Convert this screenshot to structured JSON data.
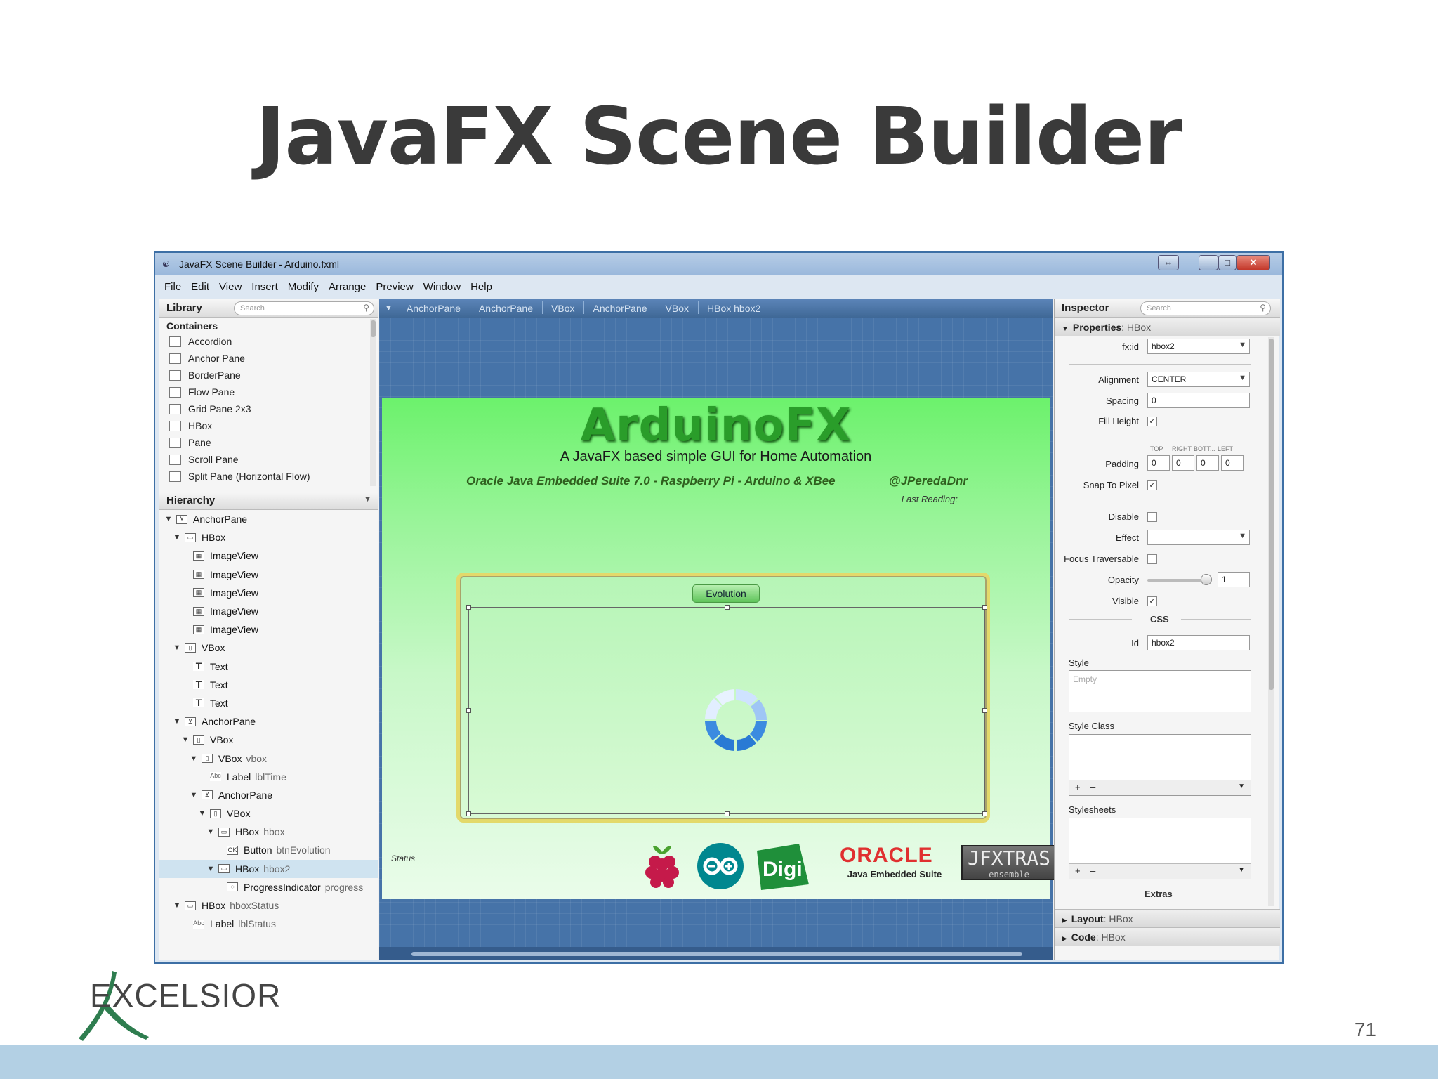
{
  "slide": {
    "title": "JavaFX Scene Builder",
    "page_number": "71",
    "logo_text": "EXCELSIOR"
  },
  "window": {
    "title": "JavaFX Scene Builder - Arduino.fxml",
    "buttons": {
      "restore": "⇔",
      "minimize": "–",
      "maximize": "□",
      "close": "✕"
    }
  },
  "menu": [
    "File",
    "Edit",
    "View",
    "Insert",
    "Modify",
    "Arrange",
    "Preview",
    "Window",
    "Help"
  ],
  "library": {
    "title": "Library",
    "search_placeholder": "Search",
    "category": "Containers",
    "items": [
      "Accordion",
      "Anchor Pane",
      "BorderPane",
      "Flow Pane",
      "Grid Pane 2x3",
      "HBox",
      "Pane",
      "Scroll Pane",
      "Split Pane (Horizontal Flow)"
    ]
  },
  "hierarchy": {
    "title": "Hierarchy",
    "rows": [
      {
        "type": "AnchorPane",
        "id": "",
        "indent": 0,
        "expanded": true,
        "icon": "anchor"
      },
      {
        "type": "HBox",
        "id": "",
        "indent": 1,
        "expanded": true,
        "icon": "hbox"
      },
      {
        "type": "ImageView",
        "id": "",
        "indent": 2,
        "expanded": null,
        "icon": "image"
      },
      {
        "type": "ImageView",
        "id": "",
        "indent": 2,
        "expanded": null,
        "icon": "image"
      },
      {
        "type": "ImageView",
        "id": "",
        "indent": 2,
        "expanded": null,
        "icon": "image"
      },
      {
        "type": "ImageView",
        "id": "",
        "indent": 2,
        "expanded": null,
        "icon": "image"
      },
      {
        "type": "ImageView",
        "id": "",
        "indent": 2,
        "expanded": null,
        "icon": "image"
      },
      {
        "type": "VBox",
        "id": "",
        "indent": 1,
        "expanded": true,
        "icon": "vbox"
      },
      {
        "type": "Text",
        "id": "",
        "indent": 2,
        "expanded": null,
        "icon": "text"
      },
      {
        "type": "Text",
        "id": "",
        "indent": 2,
        "expanded": null,
        "icon": "text"
      },
      {
        "type": "Text",
        "id": "",
        "indent": 2,
        "expanded": null,
        "icon": "text"
      },
      {
        "type": "AnchorPane",
        "id": "",
        "indent": 1,
        "expanded": true,
        "icon": "anchor"
      },
      {
        "type": "VBox",
        "id": "",
        "indent": 2,
        "expanded": true,
        "icon": "vbox"
      },
      {
        "type": "VBox",
        "id": "vbox",
        "indent": 3,
        "expanded": true,
        "icon": "vbox"
      },
      {
        "type": "Label",
        "id": "lblTime",
        "indent": 4,
        "expanded": null,
        "icon": "label"
      },
      {
        "type": "AnchorPane",
        "id": "",
        "indent": 3,
        "expanded": true,
        "icon": "anchor"
      },
      {
        "type": "VBox",
        "id": "",
        "indent": 4,
        "expanded": true,
        "icon": "vbox"
      },
      {
        "type": "HBox",
        "id": "hbox",
        "indent": 5,
        "expanded": true,
        "icon": "hbox"
      },
      {
        "type": "Button",
        "id": "btnEvolution",
        "indent": 6,
        "expanded": null,
        "icon": "button"
      },
      {
        "type": "HBox",
        "id": "hbox2",
        "indent": 5,
        "expanded": true,
        "icon": "hbox",
        "selected": true
      },
      {
        "type": "ProgressIndicator",
        "id": "progress",
        "indent": 6,
        "expanded": null,
        "icon": "progress"
      },
      {
        "type": "HBox",
        "id": "hboxStatus",
        "indent": 1,
        "expanded": true,
        "icon": "hbox"
      },
      {
        "type": "Label",
        "id": "lblStatus",
        "indent": 2,
        "expanded": null,
        "icon": "label"
      }
    ]
  },
  "breadcrumb": [
    "AnchorPane",
    "AnchorPane",
    "VBox",
    "AnchorPane",
    "VBox",
    "HBox hbox2"
  ],
  "app_preview": {
    "title": "ArduinoFX",
    "subtitle": "A JavaFX based simple GUI for Home Automation",
    "suite_line": "Oracle Java Embedded Suite 7.0 - Raspberry Pi - Arduino & XBee",
    "handle": "@JPeredaDnr",
    "last_reading": "Last Reading:",
    "evolution_button": "Evolution",
    "status": "Status",
    "oracle_logo": "ORACLE",
    "oracle_sub": "Java Embedded Suite",
    "digi_logo": "Digi",
    "jfxtras_logo": "JFXTRAS",
    "jfxtras_sub": "ensemble"
  },
  "inspector": {
    "title": "Inspector",
    "search_placeholder": "Search",
    "properties_header": "Properties",
    "properties_target": ": HBox",
    "fxid_label": "fx:id",
    "fxid_value": "hbox2",
    "alignment_label": "Alignment",
    "alignment_value": "CENTER",
    "spacing_label": "Spacing",
    "spacing_value": "0",
    "fill_height_label": "Fill Height",
    "fill_height_checked": true,
    "padding_label": "Padding",
    "padding_headers": [
      "TOP",
      "RIGHT",
      "BOTT...",
      "LEFT"
    ],
    "padding_values": [
      "0",
      "0",
      "0",
      "0"
    ],
    "snap_label": "Snap To Pixel",
    "snap_checked": true,
    "disable_label": "Disable",
    "effect_label": "Effect",
    "focus_label": "Focus Traversable",
    "opacity_label": "Opacity",
    "opacity_value": "1",
    "visible_label": "Visible",
    "css_title": "CSS",
    "id_label": "Id",
    "id_value": "hbox2",
    "style_label": "Style",
    "style_placeholder": "Empty",
    "style_class_label": "Style Class",
    "stylesheets_label": "Stylesheets",
    "extras_title": "Extras",
    "layout_header": "Layout",
    "layout_target": ": HBox",
    "code_header": "Code",
    "code_target": ": HBox"
  },
  "colors": {
    "window_border": "#3d6fa5",
    "canvas_blue": "#4673a8",
    "app_green": "#6cf26c",
    "selection_row": "#cfe3f0",
    "oracle_red": "#e03030"
  }
}
